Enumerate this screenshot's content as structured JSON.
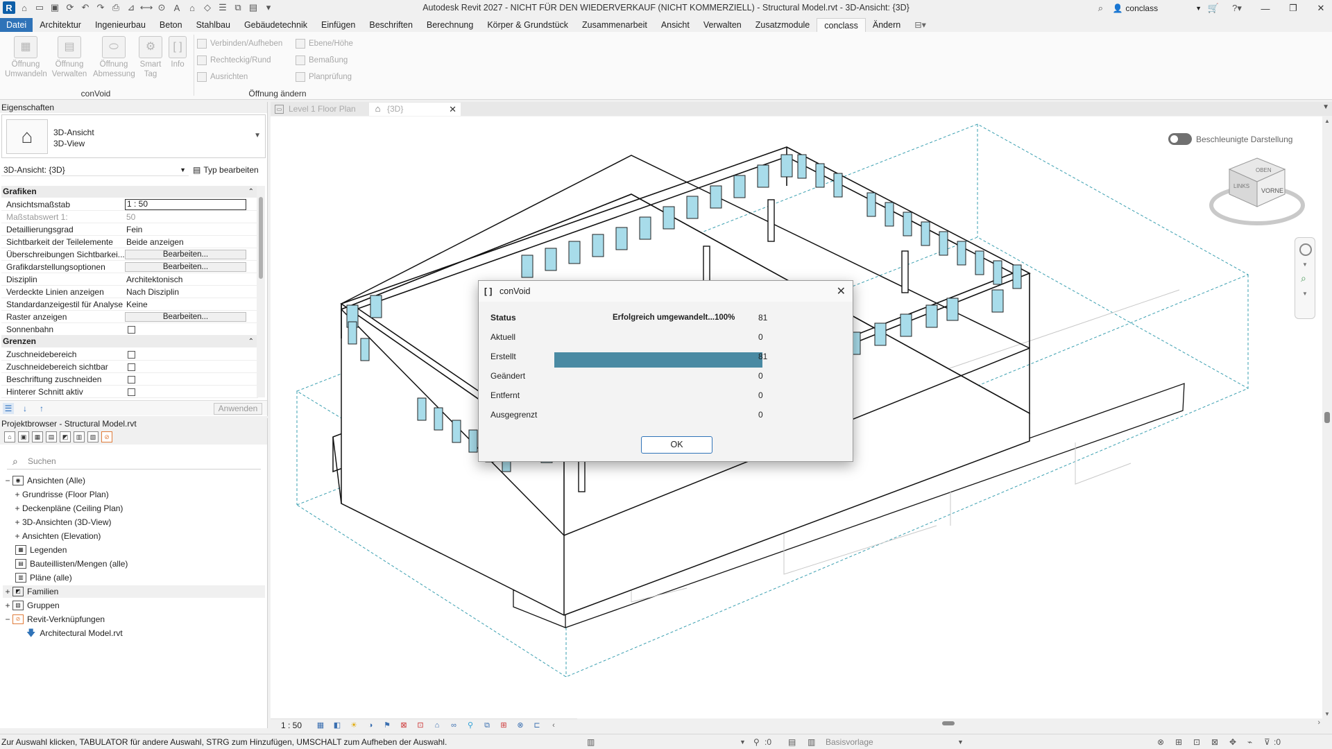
{
  "app": {
    "title": "Autodesk Revit 2027 - NICHT FÜR DEN WIEDERVERKAUF (NICHT KOMMERZIELL) - Structural Model.rvt - 3D-Ansicht: {3D}",
    "user": "conclass",
    "logo": "R"
  },
  "ribbon": {
    "tabs": [
      "Datei",
      "Architektur",
      "Ingenieurbau",
      "Beton",
      "Stahlbau",
      "Gebäudetechnik",
      "Einfügen",
      "Beschriften",
      "Berechnung",
      "Körper & Grundstück",
      "Zusammenarbeit",
      "Ansicht",
      "Verwalten",
      "Zusatzmodule",
      "conclass",
      "Ändern"
    ],
    "active_tab": "conclass",
    "panel_convoid": {
      "label": "conVoid",
      "buttons": [
        {
          "line1": "Öffnung",
          "line2": "Umwandeln"
        },
        {
          "line1": "Öffnung",
          "line2": "Verwalten"
        },
        {
          "line1": "Öffnung",
          "line2": "Abmessung"
        },
        {
          "line1": "Smart",
          "line2": "Tag"
        },
        {
          "line1": "Info",
          "line2": ""
        }
      ]
    },
    "panel_change": {
      "label": "Öffnung ändern",
      "col1": [
        "Verbinden/Aufheben",
        "Rechteckig/Rund",
        "Ausrichten"
      ],
      "col2": [
        "Ebene/Höhe",
        "Bemaßung",
        "Planprüfung"
      ]
    }
  },
  "properties": {
    "header": "Eigenschaften",
    "type_line1": "3D-Ansicht",
    "type_line2": "3D-View",
    "instance": "3D-Ansicht: {3D}",
    "edit_type": "Typ bearbeiten",
    "sections": {
      "graphics": "Grafiken",
      "extents": "Grenzen"
    },
    "rows": [
      {
        "k": "Ansichtsmaßstab",
        "v": "1 : 50"
      },
      {
        "k": "Maßstabswert 1:",
        "v": "50"
      },
      {
        "k": "Detaillierungsgrad",
        "v": "Fein"
      },
      {
        "k": "Sichtbarkeit der Teilelemente",
        "v": "Beide anzeigen"
      },
      {
        "k": "Überschreibungen Sichtbarkei...",
        "v": "Bearbeiten..."
      },
      {
        "k": "Grafikdarstellungsoptionen",
        "v": "Bearbeiten..."
      },
      {
        "k": "Disziplin",
        "v": "Architektonisch"
      },
      {
        "k": "Verdeckte Linien anzeigen",
        "v": "Nach Disziplin"
      },
      {
        "k": "Standardanzeigestil für Analyse",
        "v": "Keine"
      },
      {
        "k": "Raster anzeigen",
        "v": "Bearbeiten..."
      },
      {
        "k": "Sonnenbahn",
        "v": ""
      }
    ],
    "extent_rows": [
      {
        "k": "Zuschneidebereich"
      },
      {
        "k": "Zuschneidebereich sichtbar"
      },
      {
        "k": "Beschriftung zuschneiden"
      },
      {
        "k": "Hinterer Schnitt aktiv"
      }
    ],
    "apply": "Anwenden"
  },
  "browser": {
    "header": "Projektbrowser - Structural Model.rvt",
    "search_placeholder": "Suchen",
    "nodes": [
      {
        "exp": "−",
        "label": "Ansichten (Alle)",
        "level": 0
      },
      {
        "exp": "+",
        "label": "Grundrisse (Floor Plan)",
        "level": 1
      },
      {
        "exp": "+",
        "label": "Deckenpläne (Ceiling Plan)",
        "level": 1
      },
      {
        "exp": "+",
        "label": "3D-Ansichten (3D-View)",
        "level": 1
      },
      {
        "exp": "+",
        "label": "Ansichten (Elevation)",
        "level": 1
      },
      {
        "exp": "",
        "label": "Legenden",
        "level": 0
      },
      {
        "exp": "",
        "label": "Bauteillisten/Mengen (alle)",
        "level": 0
      },
      {
        "exp": "",
        "label": "Pläne (alle)",
        "level": 0
      },
      {
        "exp": "+",
        "label": "Familien",
        "level": 0
      },
      {
        "exp": "+",
        "label": "Gruppen",
        "level": 0
      },
      {
        "exp": "−",
        "label": "Revit-Verknüpfungen",
        "level": 0
      },
      {
        "exp": "",
        "label": "Architectural Model.rvt",
        "level": 2
      }
    ]
  },
  "doc_tabs": [
    {
      "label": "Level 1 Floor Plan",
      "active": false
    },
    {
      "label": "{3D}",
      "active": true
    }
  ],
  "viewport": {
    "accelerated_label": "Beschleunigte Darstellung",
    "viewcube_top": "OBEN",
    "viewcube_left": "LINKS",
    "viewcube_front": "VORNE"
  },
  "dialog": {
    "title": "conVoid",
    "header_label": "Status",
    "status_text": "Erfolgreich umgewandelt...100%",
    "header_count": "81",
    "progress": 1.0,
    "rows": [
      {
        "label": "Aktuell",
        "count": "0"
      },
      {
        "label": "Erstellt",
        "count": "81"
      },
      {
        "label": "Geändert",
        "count": "0"
      },
      {
        "label": "Entfernt",
        "count": "0"
      },
      {
        "label": "Ausgegrenzt",
        "count": "0"
      }
    ],
    "ok": "OK"
  },
  "viewbar": {
    "scale": "1 : 50"
  },
  "statusbar": {
    "message": "Zur Auswahl klicken, TABULATOR für andere Auswahl, STRG zum Hinzufügen, UMSCHALT zum Aufheben der Auswahl.",
    "workset_count": ":0",
    "template": "Basisvorlage",
    "filter_count": ":0"
  },
  "colors": {
    "accent": "#2f73b8",
    "progress": "#4a8aa3",
    "window_glass": "#a8dcea",
    "crop_box": "#3a9fb0"
  }
}
